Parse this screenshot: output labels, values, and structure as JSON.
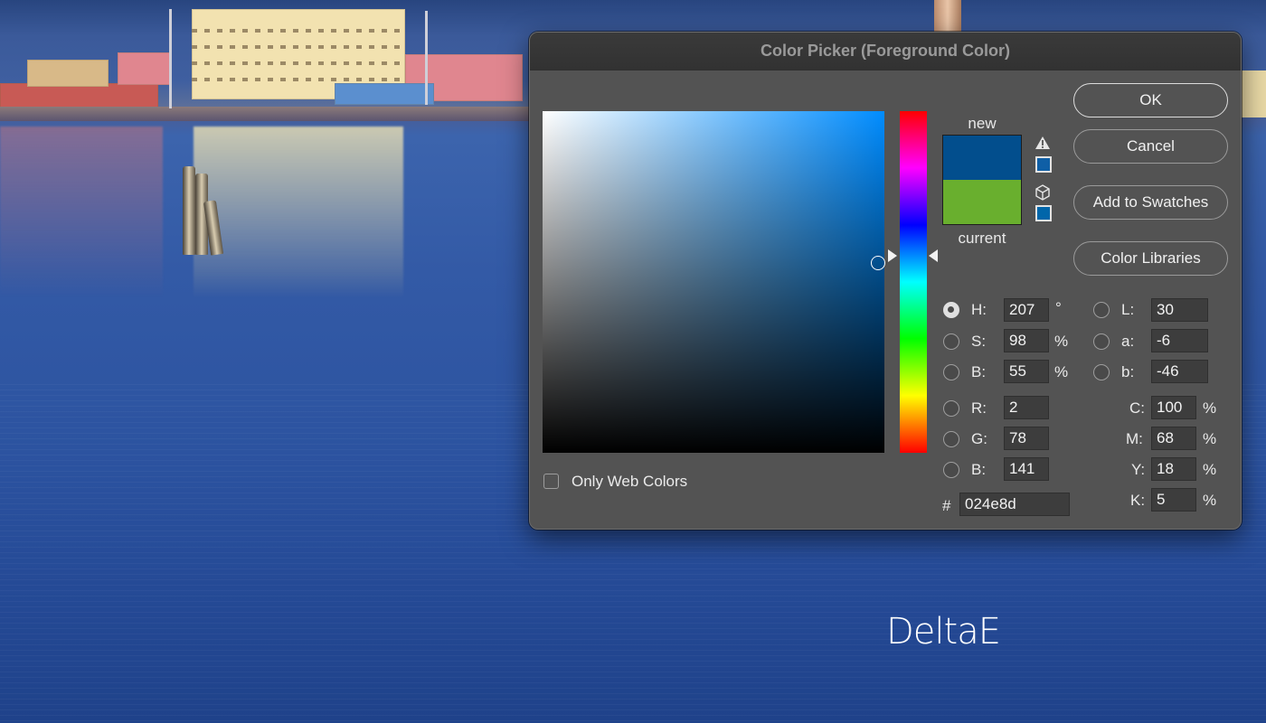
{
  "dialog": {
    "title": "Color Picker (Foreground Color)",
    "buttons": {
      "ok": "OK",
      "cancel": "Cancel",
      "add_to_swatches": "Add to Swatches",
      "color_libraries": "Color Libraries"
    },
    "swatches": {
      "new_label": "new",
      "current_label": "current",
      "new_color": "#024e8d",
      "current_color": "#69af2e",
      "gamut_warning_color": "#0f5fa6",
      "web_safe_color": "#0066aa"
    },
    "hsb": {
      "h_label": "H:",
      "h_value": "207",
      "h_unit": "°",
      "s_label": "S:",
      "s_value": "98",
      "s_unit": "%",
      "b_label": "B:",
      "b_value": "55",
      "b_unit": "%",
      "selected": "H"
    },
    "rgb": {
      "r_label": "R:",
      "r_value": "2",
      "g_label": "G:",
      "g_value": "78",
      "b_label": "B:",
      "b_value": "141"
    },
    "lab": {
      "l_label": "L:",
      "l_value": "30",
      "a_label": "a:",
      "a_value": "-6",
      "b_label": "b:",
      "b_value": "-46"
    },
    "cmyk": {
      "c_label": "C:",
      "c_value": "100",
      "c_unit": "%",
      "m_label": "M:",
      "m_value": "68",
      "m_unit": "%",
      "y_label": "Y:",
      "y_value": "18",
      "y_unit": "%",
      "k_label": "K:",
      "k_value": "5",
      "k_unit": "%"
    },
    "hex": {
      "label": "#",
      "value": "024e8d"
    },
    "only_web_colors": {
      "label": "Only Web Colors",
      "checked": false
    }
  },
  "watermark": "DeltaE"
}
